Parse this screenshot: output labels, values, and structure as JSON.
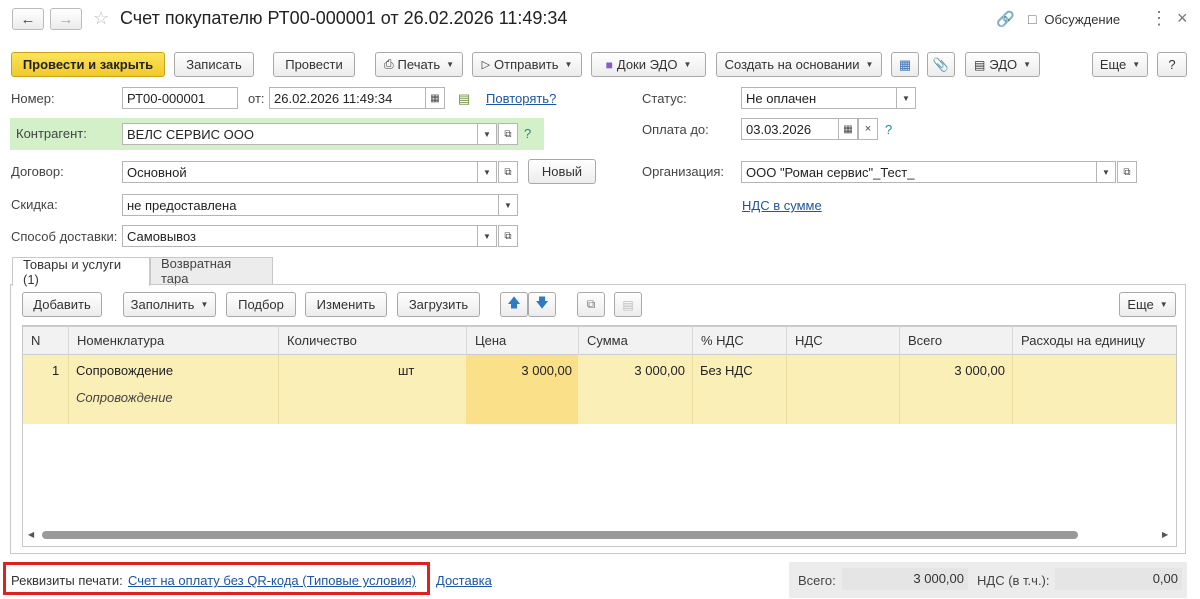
{
  "window": {
    "title": "Счет покупателю РТ00-000001 от 26.02.2026 11:49:34",
    "discussion_label": "Обсуждение"
  },
  "toolbar": {
    "post_close": "Провести и закрыть",
    "save": "Записать",
    "post": "Провести",
    "print": "Печать",
    "send": "Отправить",
    "edo_docs": "Доки ЭДО",
    "create_based": "Создать на основании",
    "edo": "ЭДО",
    "more": "Еще",
    "help": "?"
  },
  "form": {
    "number_label": "Номер:",
    "number_value": "РТ00-000001",
    "from_label": "от:",
    "date_value": "26.02.2026 11:49:34",
    "repeat_link": "Повторять?",
    "status_label": "Статус:",
    "status_value": "Не оплачен",
    "counterparty_label": "Контрагент:",
    "counterparty_value": "ВЕЛС СЕРВИС ООО",
    "pay_until_label": "Оплата до:",
    "pay_until_value": "03.03.2026",
    "contract_label": "Договор:",
    "contract_value": "Основной",
    "new_button": "Новый",
    "org_label": "Организация:",
    "org_value": "ООО \"Роман сервис\"_Тест_",
    "discount_label": "Скидка:",
    "discount_value": "не предоставлена",
    "vat_link": "НДС в сумме",
    "delivery_label": "Способ доставки:",
    "delivery_value": "Самовывоз",
    "help_mark": "?"
  },
  "tabs": [
    {
      "label": "Товары и услуги (1)"
    },
    {
      "label": "Возвратная тара"
    }
  ],
  "table_toolbar": {
    "add": "Добавить",
    "fill": "Заполнить",
    "select": "Подбор",
    "edit": "Изменить",
    "load": "Загрузить",
    "more": "Еще"
  },
  "table": {
    "headers": [
      "N",
      "Номенклатура",
      "Количество",
      "Цена",
      "Сумма",
      "% НДС",
      "НДС",
      "Всего",
      "Расходы на единицу"
    ],
    "rows": [
      {
        "n": "1",
        "item": "Сопровождение",
        "item_sub": "Сопровождение",
        "unit": "шт",
        "price": "3 000,00",
        "sum": "3 000,00",
        "vat_rate": "Без НДС",
        "total": "3 000,00"
      }
    ]
  },
  "footer": {
    "print_label": "Реквизиты печати:",
    "print_link": "Счет на оплату без QR-кода (Типовые условия)",
    "delivery_link": "Доставка",
    "total_label": "Всего:",
    "total_value": "3 000,00",
    "vat_label": "НДС (в т.ч.):",
    "vat_value": "0,00"
  },
  "colors": {
    "primary_button": "#f2c92b",
    "counterparty_highlight": "#d4f0c8",
    "row_highlight": "#fbefb8",
    "price_cell": "#fbe08a",
    "link": "#1d56a3",
    "annotation_box": "#dd2222"
  }
}
